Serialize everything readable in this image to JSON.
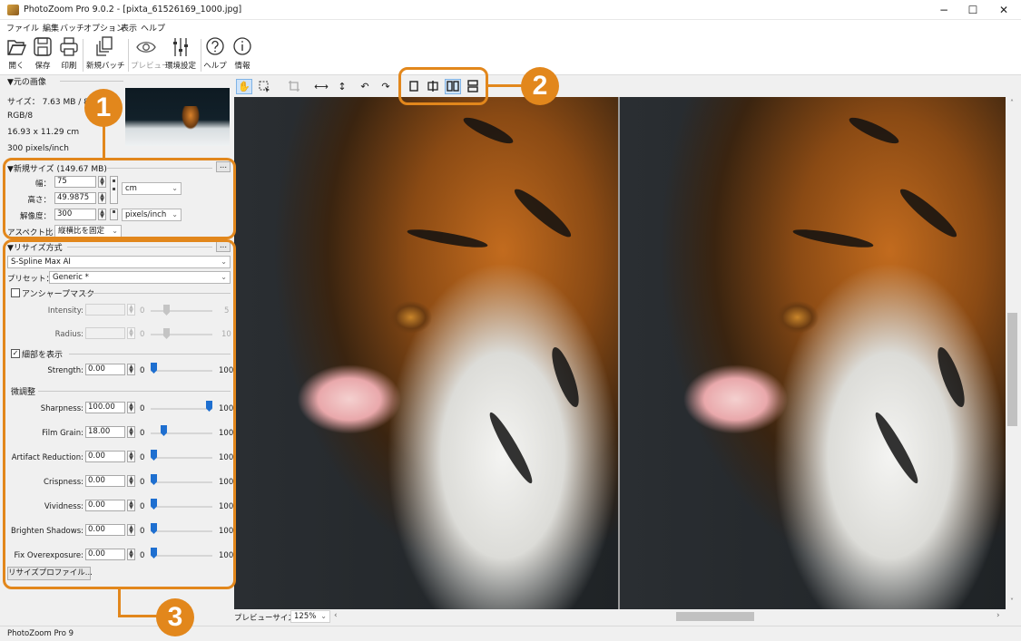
{
  "window": {
    "title": "PhotoZoom Pro 9.0.2 - [pixta_61526169_1000.jpg]",
    "minimize": "−",
    "maximize": "☐",
    "close": "✕"
  },
  "menu": [
    "ファイル",
    "編集",
    "バッチ",
    "オプション",
    "表示",
    "ヘルプ"
  ],
  "toolbar": {
    "open": "開く",
    "save": "保存",
    "print": "印刷",
    "new_batch": "新規バッチ",
    "preview": "プレビュー",
    "settings": "環境設定",
    "help": "ヘルプ",
    "info": "情報"
  },
  "original": {
    "header": "▼元の画像",
    "size": "サイズ： 7.63 MB / 82",
    "mode": "RGB/8",
    "dims": "16.93 x 11.29 cm",
    "res": "300 pixels/inch"
  },
  "new_size": {
    "header": "▼新規サイズ (149.67 MB)",
    "more": "...",
    "width_label": "幅：",
    "width": "75",
    "height_label": "高さ：",
    "height": "49.9875",
    "unit": "cm",
    "res_label": "解像度：",
    "res": "300",
    "res_unit": "pixels/inch",
    "aspect_label": "アスペクト比：",
    "aspect": "縦横比を固定"
  },
  "resize": {
    "header": "▼リサイズ方式",
    "more": "...",
    "method": "S-Spline Max AI",
    "preset_label": "プリセット：",
    "preset": "Generic *",
    "unsharp_label": "アンシャープマスク",
    "intensity_label": "Intensity:",
    "intensity_min": "0",
    "intensity_max": "5",
    "radius_label": "Radius:",
    "radius_min": "0",
    "radius_max": "10",
    "detail_label": "細部を表示",
    "detail_check": "✓",
    "strength_label": "Strength:",
    "strength": "0.00",
    "strength_value": 0,
    "fine_label": "微調整",
    "sharpness_label": "Sharpness:",
    "sharpness": "100.00",
    "sharpness_value": 100,
    "grain_label": "Film Grain:",
    "grain": "18.00",
    "grain_value": 18,
    "artifact_label": "Artifact Reduction:",
    "artifact": "0.00",
    "artifact_value": 0,
    "crisp_label": "Crispness:",
    "crisp": "0.00",
    "crisp_value": 0,
    "vivid_label": "Vividness:",
    "vivid": "0.00",
    "vivid_value": 0,
    "shadows_label": "Brighten Shadows:",
    "shadows": "0.00",
    "shadows_value": 0,
    "overexp_label": "Fix Overexposure:",
    "overexp": "0.00",
    "overexp_value": 0,
    "slider_min": "0",
    "slider_max": "100",
    "profile_button": "リサイズプロファイル..."
  },
  "preview_bar": {
    "label": "プレビューサイズ...",
    "zoom": "125%"
  },
  "status": "PhotoZoom Pro 9",
  "callouts": [
    "1",
    "2",
    "3"
  ],
  "colors": {
    "accent": "#e2871c",
    "slider": "#1e6fd0"
  }
}
